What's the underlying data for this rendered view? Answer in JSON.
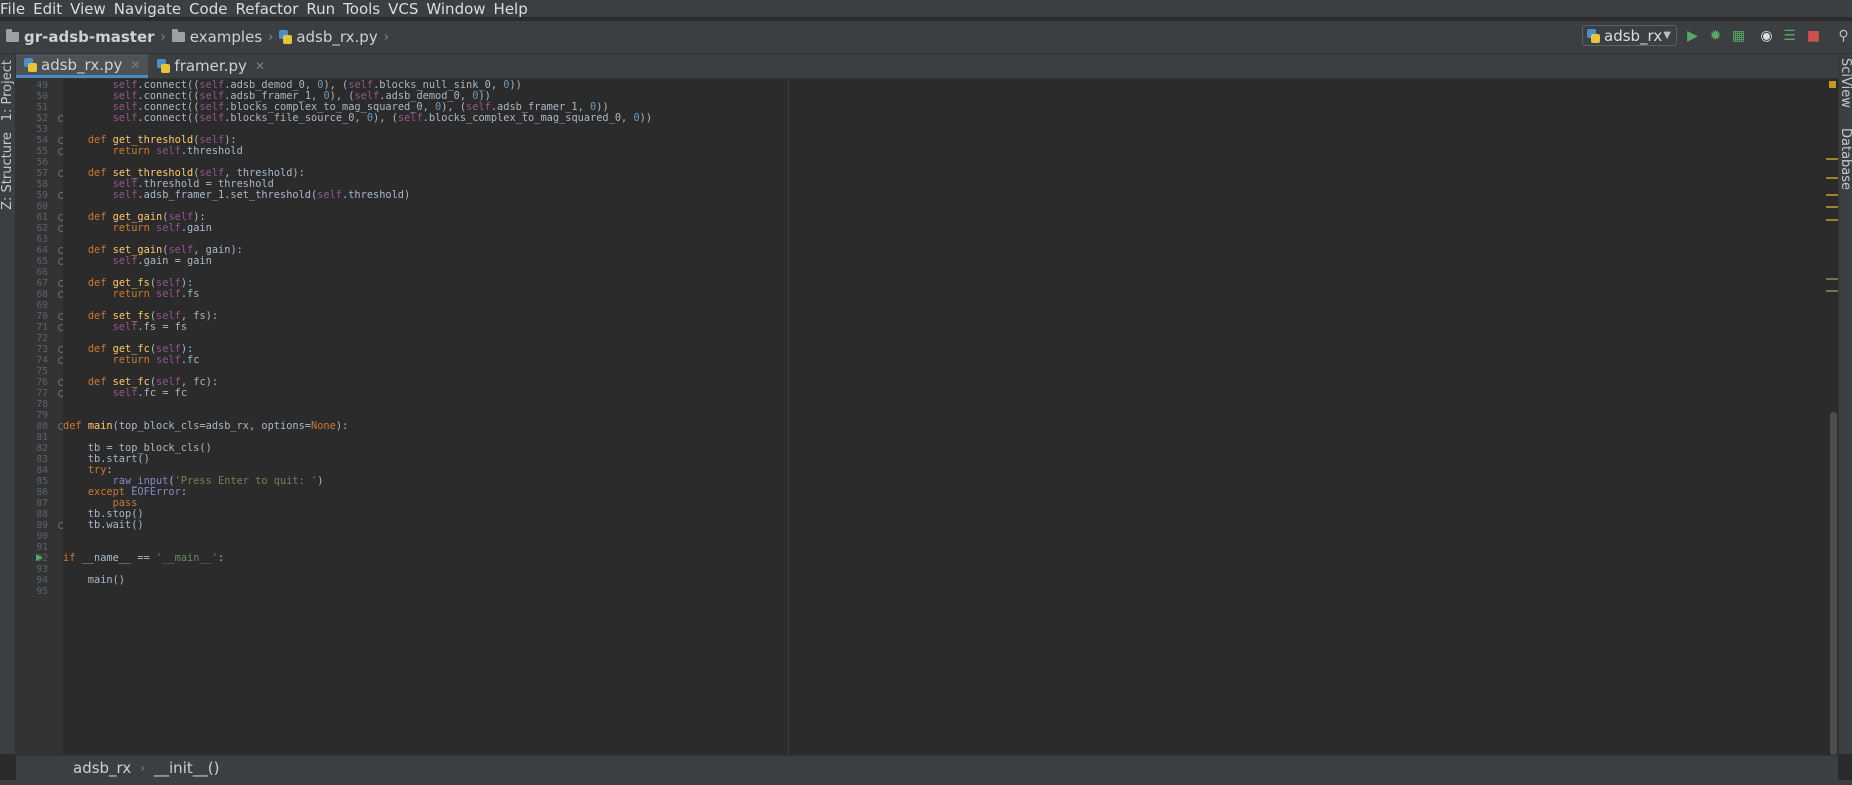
{
  "menu": [
    "File",
    "Edit",
    "View",
    "Navigate",
    "Code",
    "Refactor",
    "Run",
    "Tools",
    "VCS",
    "Window",
    "Help"
  ],
  "nav": {
    "project": "gr-adsb-master",
    "folder": "examples",
    "file": "adsb_rx.py"
  },
  "run_config": {
    "label": "adsb_rx"
  },
  "tabs": [
    {
      "label": "adsb_rx.py",
      "active": true
    },
    {
      "label": "framer.py",
      "active": false
    }
  ],
  "left_tools": {
    "project": "1: Project",
    "structure": "Z: Structure"
  },
  "right_tools": {
    "sciview": "SciView",
    "database": "Database"
  },
  "breadcrumb": {
    "class_name": "adsb_rx",
    "method": "__init__()"
  },
  "code": [
    {
      "n": "49",
      "text": "        self.connect((self.adsb_demod_0, 0), (self.blocks_null_sink_0, 0))"
    },
    {
      "n": "50",
      "text": "        self.connect((self.adsb_framer_1, 0), (self.adsb_demod_0, 0))"
    },
    {
      "n": "51",
      "text": "        self.connect((self.blocks_complex_to_mag_squared_0, 0), (self.adsb_framer_1, 0))"
    },
    {
      "n": "52",
      "text": "        self.connect((self.blocks_file_source_0, 0), (self.blocks_complex_to_mag_squared_0, 0))"
    },
    {
      "n": "53",
      "text": ""
    },
    {
      "n": "54",
      "text": "    def get_threshold(self):"
    },
    {
      "n": "55",
      "text": "        return self.threshold"
    },
    {
      "n": "56",
      "text": ""
    },
    {
      "n": "57",
      "text": "    def set_threshold(self, threshold):"
    },
    {
      "n": "58",
      "text": "        self.threshold = threshold"
    },
    {
      "n": "59",
      "text": "        self.adsb_framer_1.set_threshold(self.threshold)"
    },
    {
      "n": "60",
      "text": ""
    },
    {
      "n": "61",
      "text": "    def get_gain(self):"
    },
    {
      "n": "62",
      "text": "        return self.gain"
    },
    {
      "n": "63",
      "text": ""
    },
    {
      "n": "64",
      "text": "    def set_gain(self, gain):"
    },
    {
      "n": "65",
      "text": "        self.gain = gain"
    },
    {
      "n": "66",
      "text": ""
    },
    {
      "n": "67",
      "text": "    def get_fs(self):"
    },
    {
      "n": "68",
      "text": "        return self.fs"
    },
    {
      "n": "69",
      "text": ""
    },
    {
      "n": "70",
      "text": "    def set_fs(self, fs):"
    },
    {
      "n": "71",
      "text": "        self.fs = fs"
    },
    {
      "n": "72",
      "text": ""
    },
    {
      "n": "73",
      "text": "    def get_fc(self):"
    },
    {
      "n": "74",
      "text": "        return self.fc"
    },
    {
      "n": "75",
      "text": ""
    },
    {
      "n": "76",
      "text": "    def set_fc(self, fc):"
    },
    {
      "n": "77",
      "text": "        self.fc = fc"
    },
    {
      "n": "78",
      "text": ""
    },
    {
      "n": "79",
      "text": ""
    },
    {
      "n": "80",
      "text": "def main(top_block_cls=adsb_rx, options=None):"
    },
    {
      "n": "81",
      "text": ""
    },
    {
      "n": "82",
      "text": "    tb = top_block_cls()"
    },
    {
      "n": "83",
      "text": "    tb.start()"
    },
    {
      "n": "84",
      "text": "    try:"
    },
    {
      "n": "85",
      "text": "        raw_input('Press Enter to quit: ')"
    },
    {
      "n": "86",
      "text": "    except EOFError:"
    },
    {
      "n": "87",
      "text": "        pass"
    },
    {
      "n": "88",
      "text": "    tb.stop()"
    },
    {
      "n": "89",
      "text": "    tb.wait()"
    },
    {
      "n": "90",
      "text": ""
    },
    {
      "n": "91",
      "text": ""
    },
    {
      "n": "92",
      "text": "if __name__ == '__main__':"
    },
    {
      "n": "93",
      "text": ""
    },
    {
      "n": "94",
      "text": "    main()"
    },
    {
      "n": "95",
      "text": ""
    }
  ],
  "colors": {
    "background": "#2b2b2b",
    "keyword": "#cc7832",
    "self": "#94558d",
    "function": "#ffc66d",
    "number": "#6897bb",
    "string": "#6a8759",
    "accent": "#4a88c7"
  }
}
